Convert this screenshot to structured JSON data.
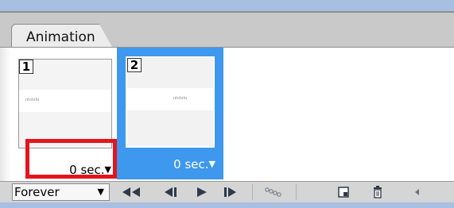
{
  "panel": {
    "tab_label": "Animation"
  },
  "frames": [
    {
      "number": "1",
      "delay": "0 sec.",
      "selected": false
    },
    {
      "number": "2",
      "delay": "0 sec.",
      "selected": true
    }
  ],
  "toolbar": {
    "loop_value": "Forever"
  },
  "icons": {
    "dropdown": "caret-down-icon",
    "first_frame": "rewind-to-first-frame-icon",
    "previous_frame": "previous-frame-icon",
    "play": "play-icon",
    "next_frame": "next-frame-icon",
    "tween": "tween-icon",
    "duplicate_frame": "duplicate-frame-icon",
    "delete_frame": "trash-icon",
    "scroll_left": "scroll-left-icon"
  },
  "colors": {
    "selection_blue": "#3e98ee",
    "highlight_red": "#e4141e"
  }
}
